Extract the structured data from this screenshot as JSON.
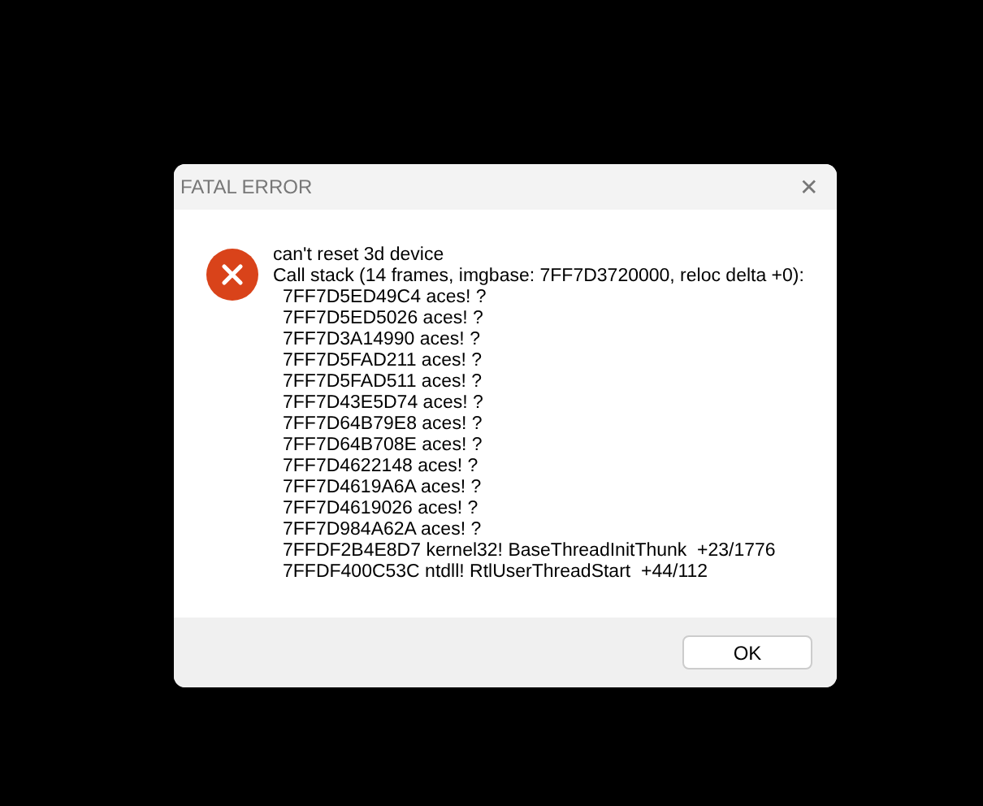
{
  "window": {
    "title": "FATAL ERROR",
    "close": "✕"
  },
  "message": {
    "kind": "error",
    "lines": [
      "can't reset 3d device",
      "Call stack (14 frames, imgbase: 7FF7D3720000, reloc delta +0):"
    ],
    "frames": [
      "7FF7D5ED49C4 aces! ?",
      "7FF7D5ED5026 aces! ?",
      "7FF7D3A14990 aces! ?",
      "7FF7D5FAD211 aces! ?",
      "7FF7D5FAD511 aces! ?",
      "7FF7D43E5D74 aces! ?",
      "7FF7D64B79E8 aces! ?",
      "7FF7D64B708E aces! ?",
      "7FF7D4622148 aces! ?",
      "7FF7D4619A6A aces! ?",
      "7FF7D4619026 aces! ?",
      "7FF7D984A62A aces! ?",
      "7FFDF2B4E8D7 kernel32! BaseThreadInitThunk  +23/1776",
      "7FFDF400C53C ntdll! RtlUserThreadStart  +44/112"
    ]
  },
  "buttons": [
    "OK"
  ]
}
